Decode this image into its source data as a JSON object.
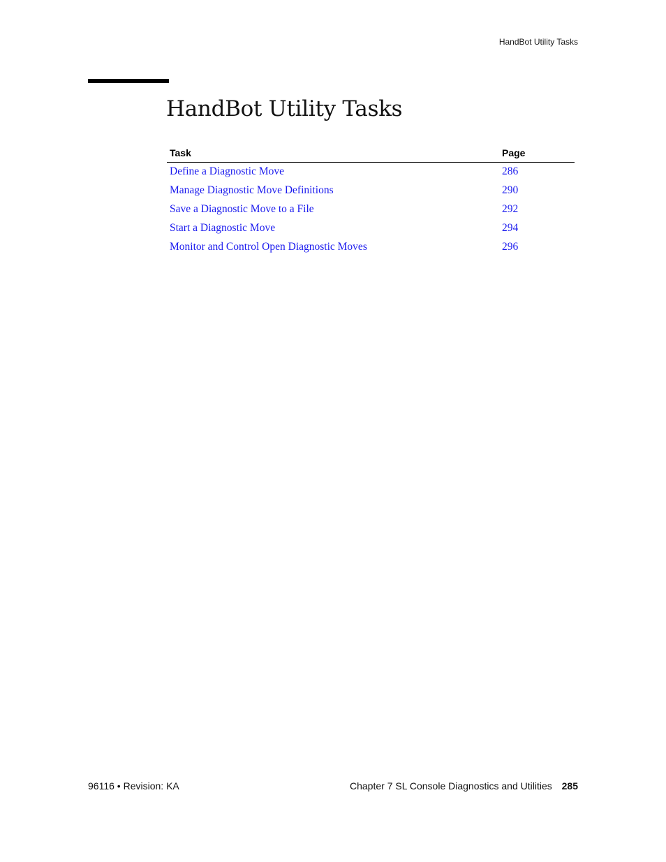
{
  "header": {
    "running_title": "HandBot Utility Tasks"
  },
  "title": "HandBot Utility Tasks",
  "table": {
    "columns": [
      "Task",
      "Page"
    ],
    "rows": [
      {
        "task": "Define a Diagnostic Move",
        "page": "286"
      },
      {
        "task": "Manage Diagnostic Move Definitions",
        "page": "290"
      },
      {
        "task": "Save a Diagnostic Move to a File",
        "page": "292"
      },
      {
        "task": "Start a Diagnostic Move",
        "page": "294"
      },
      {
        "task": "Monitor and Control Open Diagnostic Moves",
        "page": "296"
      }
    ],
    "link_color": "#1a1aee"
  },
  "footer": {
    "doc_id": "96116",
    "separator": "•",
    "revision": "Revision: KA",
    "chapter": "Chapter 7 SL Console Diagnostics and Utilities",
    "page_number": "285"
  }
}
